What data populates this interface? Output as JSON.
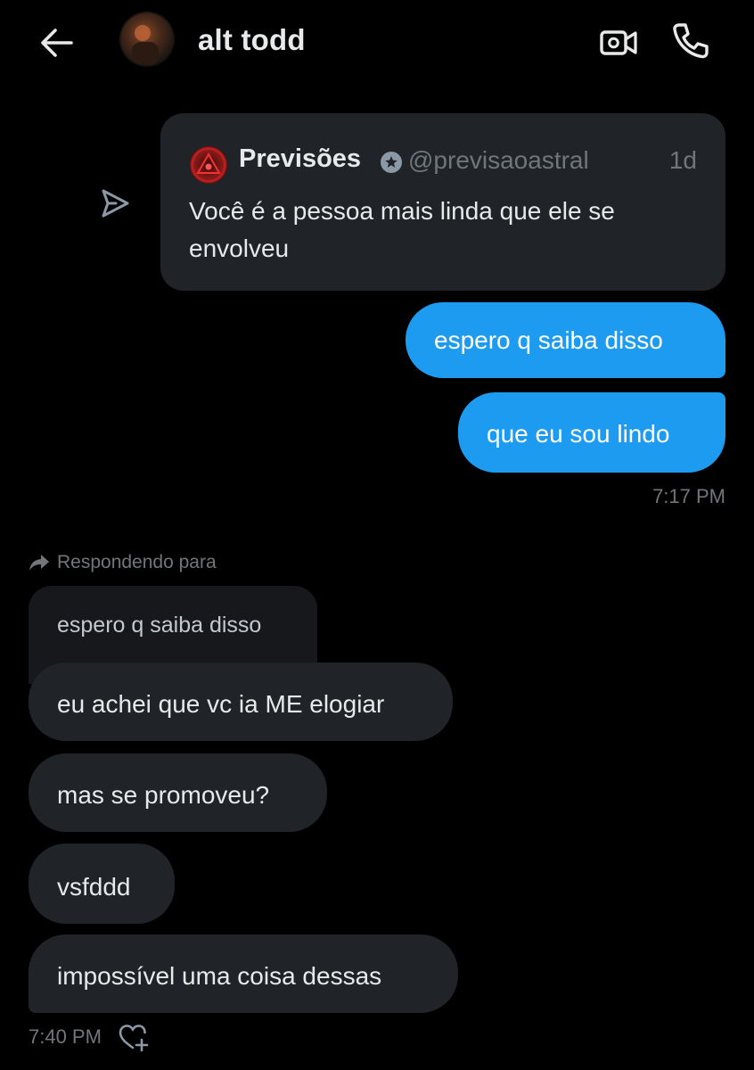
{
  "header": {
    "contact_name": "alt todd",
    "back_icon": "arrow-left-icon",
    "video_icon": "video-call-icon",
    "call_icon": "phone-icon"
  },
  "shared_tweet": {
    "author": "Previsões",
    "handle": "@previsaoastral",
    "time": "1d",
    "text": "Você é a pessoa mais linda que ele se envolveu"
  },
  "messages": {
    "out1": "espero q saiba disso",
    "out2": "que eu sou lindo",
    "out_timestamp": "7:17 PM",
    "reply_label": "Respondendo para",
    "reply_quote": "espero q saiba disso",
    "in1": "eu achei que vc ia ME elogiar",
    "in2": "mas se promoveu?",
    "in3": "vsfddd",
    "in4": "impossível uma coisa dessas",
    "in_timestamp": "7:40 PM"
  },
  "colors": {
    "background": "#000000",
    "outgoing_bubble": "#1d9bf0",
    "incoming_bubble": "#202327",
    "muted_text": "#71767b"
  }
}
